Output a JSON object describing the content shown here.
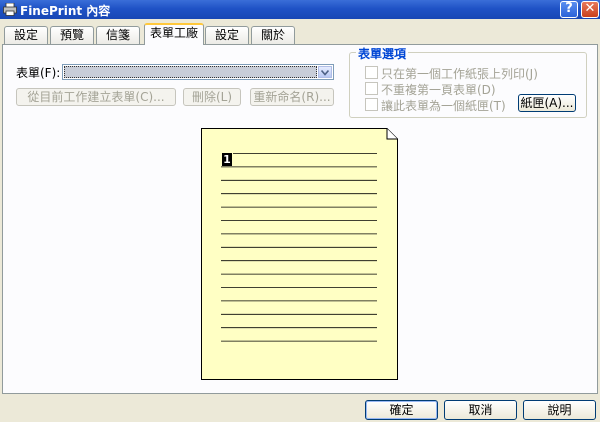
{
  "window": {
    "title": "FinePrint 內容",
    "help_glyph": "?",
    "close_glyph": "✕"
  },
  "tabs": [
    {
      "label": "設定"
    },
    {
      "label": "預覽"
    },
    {
      "label": "信箋"
    },
    {
      "label": "表單工廠",
      "active": true
    },
    {
      "label": "設定"
    },
    {
      "label": "關於"
    }
  ],
  "form": {
    "label": "表單(F):",
    "selected_value": "",
    "create_button": "從目前工作建立表單(C)...",
    "delete_button": "刪除(L)",
    "rename_button": "重新命名(R)..."
  },
  "form_options": {
    "title": "表單選項",
    "checkboxes": [
      {
        "label": "只在第一個工作紙張上列印(J)",
        "checked": false
      },
      {
        "label": "不重複第一頁表單(D)",
        "checked": false
      },
      {
        "label": "讓此表單為一個紙匣(T)",
        "checked": false
      }
    ],
    "tray_button": "紙匣(A)..."
  },
  "preview": {
    "page_number": "1",
    "paper_color": "#ffffc4"
  },
  "footer": {
    "ok": "確定",
    "cancel": "取消",
    "help": "說明"
  }
}
